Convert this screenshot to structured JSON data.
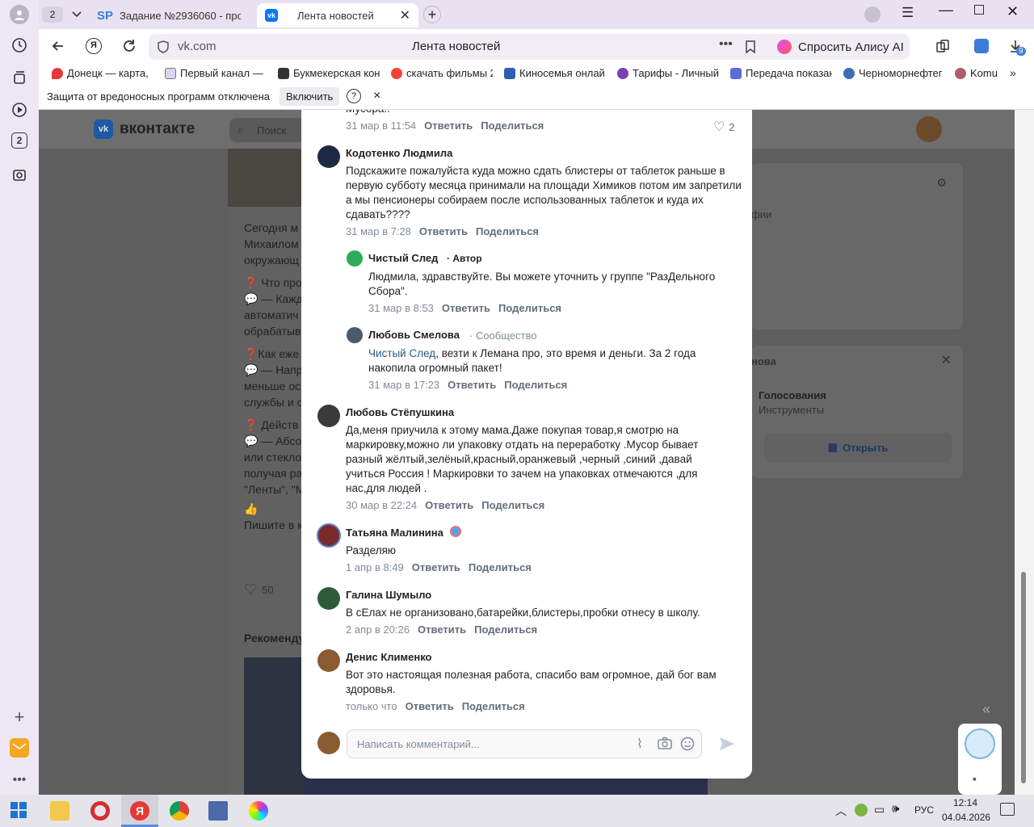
{
  "browser": {
    "tab_count_badge": "2",
    "tabs": [
      {
        "title": "Задание №2936060 - про",
        "favicon": "SP"
      },
      {
        "title": "Лента новостей",
        "favicon": "vk-logo"
      }
    ],
    "address": {
      "domain": "vk.com",
      "page_title": "Лента новостей"
    },
    "alice_button": "Спросить Алису AI",
    "downloads_badge": "9",
    "bookmarks": [
      "Донецк — карта, с",
      "Первый канал — с",
      "Букмекерская кон",
      "скачать фильмы 2",
      "Киносемья онлай",
      "Тарифы - Личный",
      "Передача показан",
      "Черноморнефтег",
      "Komu"
    ],
    "protection_bar": {
      "text": "Защита от вредоносных программ отключена",
      "button": "Включить",
      "help": "?",
      "close": "×"
    },
    "sidebar_badge": "2"
  },
  "vk": {
    "logo_text": "вконтакте",
    "search_placeholder": "Поиск",
    "post_bg_lines": [
      "Сегодня м",
      "Михаилом",
      "окружающ",
      "❓ Что про",
      "💬 — Кажд",
      "автоматич",
      "обрабатыв",
      "❓Как еже",
      "💬 — Напр",
      "меньше ос",
      "службы и с",
      "❓ Действ",
      "💬 — Абсо",
      "или стекло",
      "получая ра",
      "\"Ленты\", \"М",
      "👍",
      "Пишите в к"
    ],
    "likes_count": "50",
    "recommend": "Рекоменду",
    "right_widget": {
      "fragment1": "фии",
      "fragment2": "нова",
      "voting_title": "Голосования",
      "voting_sub": "Инструменты",
      "open_button": "Открыть"
    }
  },
  "comments": {
    "top_fragment": "Мусора!!",
    "top_meta": {
      "time": "31 мар в 11:54",
      "reply": "Ответить",
      "share": "Поделиться",
      "likes": "2"
    },
    "items": [
      {
        "author": "Кодотенко Людмила",
        "text": "Подскажите пожалуйста куда можно сдать блистеры от таблеток раньше в первую субботу месяца принимали на площади Химиков потом им запретили а мы пенсионеры собираем после использованных таблеток и куда их сдавать????",
        "time": "31 мар в 7:28",
        "reply": "Ответить",
        "share": "Поделиться"
      },
      {
        "author": "Чистый След",
        "tag": "· Автор",
        "text": "Людмила, здравствуйте. Вы можете уточнить у группе \"РазДельного Сбора\".",
        "time": "31 мар в 8:53",
        "reply": "Ответить",
        "share": "Поделиться"
      },
      {
        "author": "Любовь Смелова",
        "tag": "· Сообщество",
        "mention": "Чистый След",
        "text": ", везти к Лемана про, это время и деньги. За 2 года накопила огромный пакет!",
        "time": "31 мар в 17:23",
        "reply": "Ответить",
        "share": "Поделиться"
      },
      {
        "author": "Любовь Стёпушкина",
        "text": "Да,меня приучила к этому мама.Даже покупая товар,я смотрю на маркировку,можно ли упаковку отдать на переработку .Мусор бывает разный жёлтый,зелёный,красный,оранжевый ,черный ,синий ,давай учиться Россия ! Маркировки то зачем на упаковках отмечаются ,для нас,для людей .",
        "time": "30 мар в 22:24",
        "reply": "Ответить",
        "share": "Поделиться"
      },
      {
        "author": "Татьяна Малинина",
        "text": "Разделяю",
        "time": "1 апр в 8:49",
        "reply": "Ответить",
        "share": "Поделиться"
      },
      {
        "author": "Галина Шумыло",
        "text": "В сЕлах не организовано,батарейки,блистеры,пробки отнесу в школу.",
        "time": "2 апр в 20:26",
        "reply": "Ответить",
        "share": "Поделиться"
      },
      {
        "author": "Денис Клименко",
        "text": "Вот это настоящая полезная работа, спасибо вам огромное, дай бог вам здоровья.",
        "time": "только что",
        "reply": "Ответить",
        "share": "Поделиться"
      }
    ],
    "input_placeholder": "Написать комментарий..."
  },
  "taskbar": {
    "lang": "РУС",
    "time": "12:14",
    "date": "04.04.2026"
  },
  "colors": {
    "vk_blue": "#2a5885",
    "meta_gray": "#818c99",
    "accent_pink": "#e91e63"
  }
}
